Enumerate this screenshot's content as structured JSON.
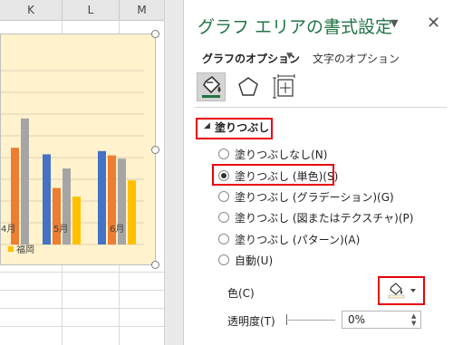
{
  "sheet": {
    "columns": [
      "K",
      "L",
      "M"
    ],
    "chart_legend_label": "福岡",
    "chart_month_labels": [
      "4月",
      "5月",
      "6月"
    ]
  },
  "chart_data": {
    "type": "bar",
    "categories": [
      "4月",
      "5月",
      "6月"
    ],
    "series": [
      {
        "name": "",
        "color": "#4472c4",
        "values": [
          null,
          83,
          86
        ]
      },
      {
        "name": "",
        "color": "#ed7d31",
        "values": [
          89,
          52,
          82
        ]
      },
      {
        "name": "",
        "color": "#a5a5a5",
        "values": [
          116,
          70,
          79
        ]
      },
      {
        "name": "福岡",
        "color": "#ffc000",
        "values": [
          null,
          44,
          59
        ]
      }
    ]
  },
  "pane": {
    "title": "グラフ エリアの書式設定",
    "tab_graph_options": "グラフのオプション",
    "tab_text_options": "文字のオプション",
    "icons": [
      "fill-line-icon",
      "effects-pentagon-icon",
      "size-properties-icon"
    ],
    "section_label": "塗りつぶし",
    "fill_options": [
      {
        "label": "塗りつぶしなし(N)",
        "checked": false
      },
      {
        "label": "塗りつぶし (単色)(S)",
        "checked": true
      },
      {
        "label": "塗りつぶし (グラデーション)(G)",
        "checked": false
      },
      {
        "label": "塗りつぶし (図またはテクスチャ)(P)",
        "checked": false
      },
      {
        "label": "塗りつぶし (パターン)(A)",
        "checked": false
      },
      {
        "label": "自動(U)",
        "checked": false
      }
    ],
    "color_label": "色(C)",
    "transparency_label": "透明度(T)",
    "transparency_value": "0%",
    "accent_color": "#217346",
    "highlight_color": "#e8000b"
  }
}
